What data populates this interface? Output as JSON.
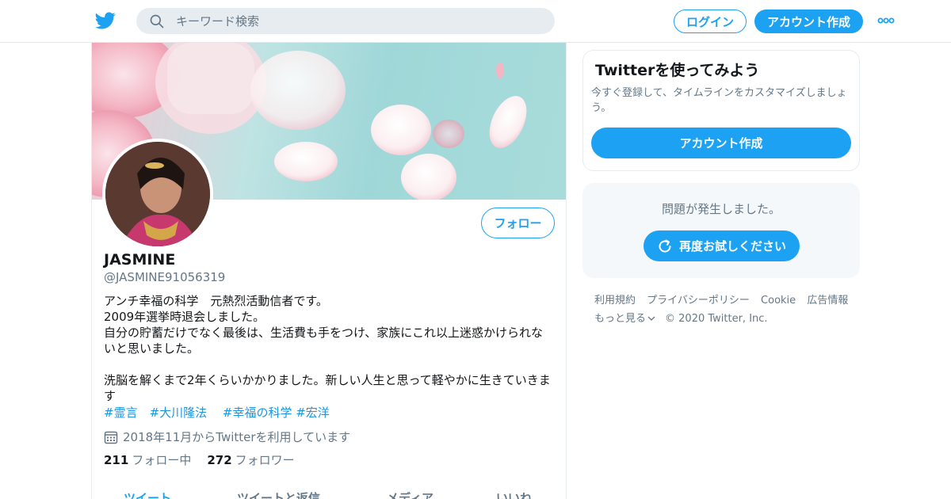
{
  "header": {
    "search_placeholder": "キーワード検索",
    "login_label": "ログイン",
    "signup_label": "アカウント作成"
  },
  "profile": {
    "name": "JASMINE",
    "handle": "@JASMINE91056319",
    "follow_label": "フォロー",
    "bio_lines": [
      "アンチ幸福の科学　元熱烈活動信者です。",
      "2009年選挙時退会しました。",
      "自分の貯蓄だけでなく最後は、生活費も手をつけ、家族にこれ以上迷惑かけられな",
      "いと思いました。",
      "",
      "洗脳を解くまで2年くらいかかりました。新しい人生と思って軽やかに生きていきま",
      "す"
    ],
    "hashtags": "#霊言　#大川隆法　 #幸福の科学 #宏洋",
    "joined": "2018年11月からTwitterを利用しています",
    "following_count": "211",
    "following_label": "フォロー中",
    "followers_count": "272",
    "followers_label": "フォロワー",
    "tabs": [
      "ツイート",
      "ツイートと返信",
      "メディア",
      "いいね"
    ]
  },
  "signup_card": {
    "title": "Twitterを使ってみよう",
    "description": "今すぐ登録して、タイムラインをカスタマイズしましょう。",
    "button_label": "アカウント作成"
  },
  "error_card": {
    "message": "問題が発生しました。",
    "retry_label": "再度お試しください"
  },
  "footer": {
    "links": [
      "利用規約",
      "プライバシーポリシー",
      "Cookie",
      "広告情報",
      "もっと見る"
    ],
    "copyright": "© 2020 Twitter, Inc."
  },
  "colors": {
    "brand": "#1da1f2",
    "secondary_text": "#657786",
    "hashtag": "#1b95e0"
  }
}
